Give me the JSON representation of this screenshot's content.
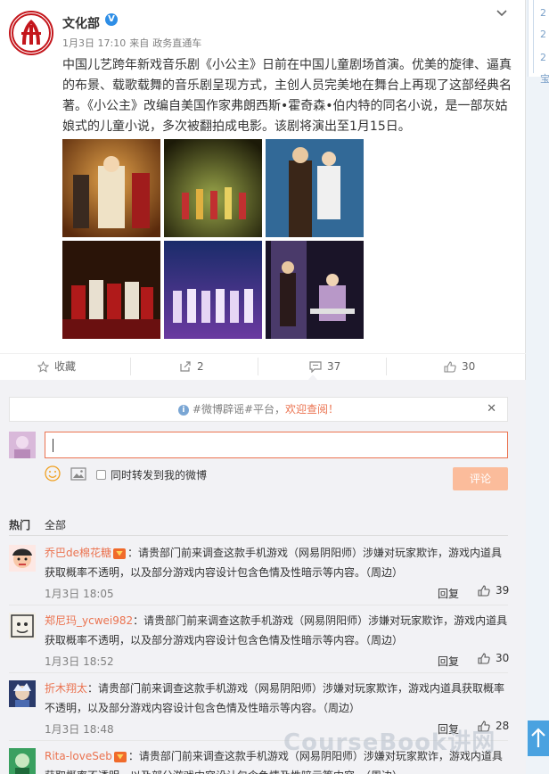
{
  "post": {
    "username": "文化部",
    "verified_badge": "V",
    "time": "1月3日 17:10",
    "source_prefix": "来自",
    "source": "政务直通车",
    "paragraph1": "中国儿艺跨年新戏音乐剧《小公主》日前在中国儿童剧场首演。优美的旋律、逼真的布景、载歌载舞的音乐剧呈现方式，主创人员完美地在舞台上再现了这部经典名著。《小公主》改编自美国作家弗朗西斯•霍奇森•伯内特的同名小说，是一部灰姑娘式的儿童小说，多次被翻拍成电影。该剧将演出至1月15日。"
  },
  "actions": {
    "favorite_label": "收藏",
    "repost_count": "2",
    "comment_count": "37",
    "like_count": "30"
  },
  "notice": {
    "prefix": "#微博辟谣#平台，",
    "link": "欢迎查阅！",
    "close": "✕"
  },
  "composer": {
    "forward_label": "同时转发到我的微博",
    "submit_label": "评论"
  },
  "filters": {
    "hot": "热门",
    "all": "全部"
  },
  "comments": [
    {
      "name": "乔巴de棉花糖",
      "vip": true,
      "text": "：请贵部门前来调查这款手机游戏（网易阴阳师）涉嫌对玩家欺诈，游戏内道具获取概率不透明，以及部分游戏内容设计包含色情及性暗示等内容。（周边）",
      "time": "1月3日 18:05",
      "reply": "回复",
      "likes": "39"
    },
    {
      "name": "郑尼玛_ycwei982",
      "vip": false,
      "text": "：请贵部门前来调查这款手机游戏（网易阴阳师）涉嫌对玩家欺诈，游戏内道具获取概率不透明，以及部分游戏内容设计包含色情及性暗示等内容。（周边）",
      "time": "1月3日 18:52",
      "reply": "回复",
      "likes": "30"
    },
    {
      "name": "折木翔太",
      "vip": false,
      "text": "：请贵部门前来调查这款手机游戏（网易阴阳师）涉嫌对玩家欺诈，游戏内道具获取概率不透明，以及部分游戏内容设计包含色情及性暗示等内容。（周边）",
      "time": "1月3日 18:48",
      "reply": "回复",
      "likes": "28"
    },
    {
      "name": "Rita-loveSeb",
      "vip": true,
      "text": "：请贵部门前来调查这款手机游戏（网易阴阳师）涉嫌对玩家欺诈，游戏内道具获取概率不透明，以及部分游戏内容设计包含色情及性暗示等内容。（周边）",
      "time": "",
      "reply": "",
      "likes": ""
    }
  ],
  "sidebar": {
    "items": [
      "2",
      "2",
      "2"
    ],
    "partial_label": "宝"
  },
  "watermark": "CourseBook讲网",
  "colors": {
    "accent": "#eb7350",
    "link_blue": "#2e8ee6",
    "page_bg": "#f2f2f5"
  }
}
